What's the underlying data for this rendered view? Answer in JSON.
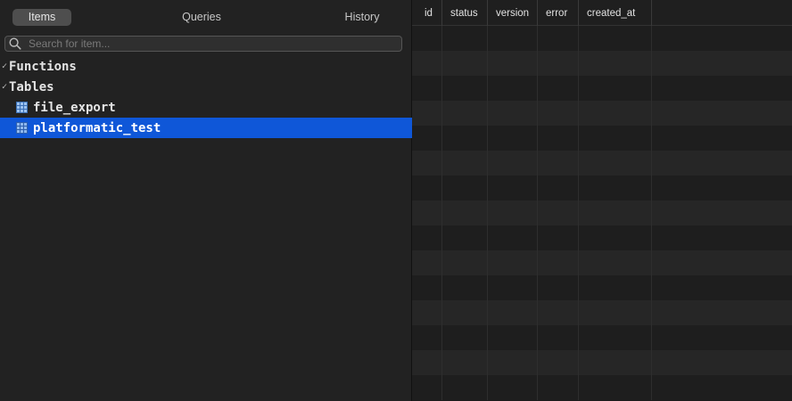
{
  "tabs": {
    "items": "Items",
    "queries": "Queries",
    "history": "History"
  },
  "search": {
    "placeholder": "Search for item...",
    "value": ""
  },
  "tree": {
    "functions_label": "Functions",
    "tables_label": "Tables",
    "tables": [
      {
        "name": "file_export",
        "selected": false
      },
      {
        "name": "platformatic_test",
        "selected": true
      }
    ]
  },
  "grid": {
    "columns": [
      "id",
      "status",
      "version",
      "error",
      "created_at"
    ]
  },
  "colors": {
    "selection": "#0f57d8",
    "sidebar_bg": "#222222",
    "grid_bg": "#1c1c1c",
    "table_icon": "#4a7fc0"
  }
}
